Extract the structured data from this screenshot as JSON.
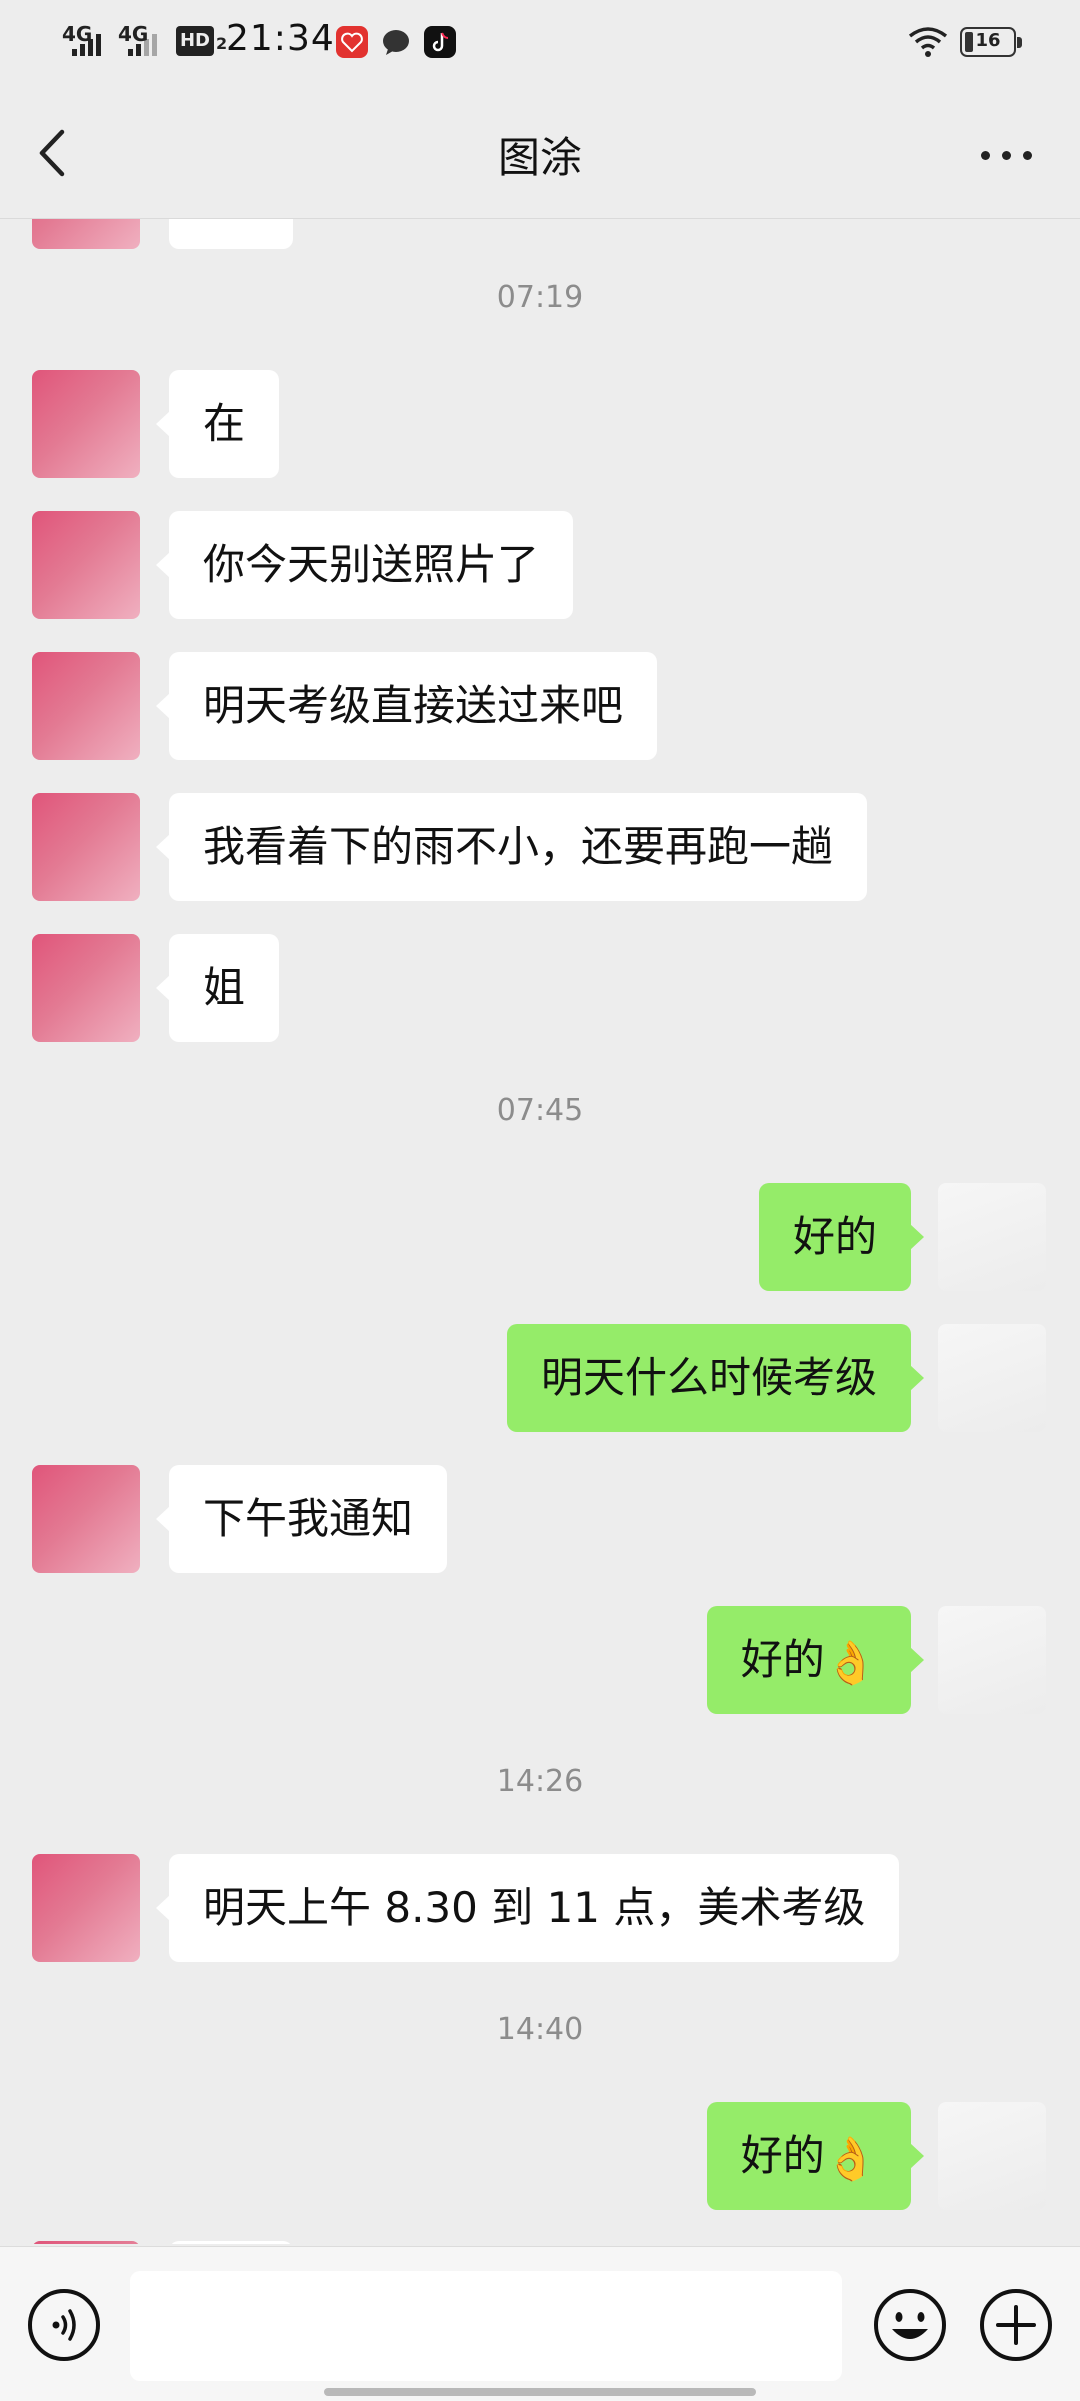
{
  "status_bar": {
    "network_1": "4G",
    "network_2": "4G",
    "hd_label": "HD",
    "hd_sub": "2",
    "time": "21:34",
    "app_icons": [
      "heart-app-icon",
      "chat-bubble-icon",
      "tiktok-icon"
    ],
    "battery_level": "16"
  },
  "nav": {
    "title": "图涂"
  },
  "chat": {
    "timestamps": [
      "07:19",
      "07:45",
      "14:26",
      "14:40"
    ],
    "messages": [
      {
        "side": "in",
        "text": "在"
      },
      {
        "side": "in",
        "text": "你今天别送照片了"
      },
      {
        "side": "in",
        "text": "明天考级直接送过来吧"
      },
      {
        "side": "in",
        "text": "我看着下的雨不小，还要再跑一趟"
      },
      {
        "side": "in",
        "text": "姐"
      },
      {
        "side": "out",
        "text": "好的"
      },
      {
        "side": "out",
        "text": "明天什么时候考级"
      },
      {
        "side": "in",
        "text": "下午我通知"
      },
      {
        "side": "out",
        "text": "好的",
        "emoji": "👌"
      },
      {
        "side": "in",
        "text": "明天上午 8.30 到 11 点，美术考级"
      },
      {
        "side": "out",
        "text": "好的",
        "emoji": "👌"
      }
    ]
  },
  "input_bar": {
    "placeholder": ""
  },
  "colors": {
    "background": "#EDEDED",
    "incoming_bubble": "#FFFFFF",
    "outgoing_bubble": "#95EC69",
    "timestamp_text": "#8C8C8C"
  }
}
